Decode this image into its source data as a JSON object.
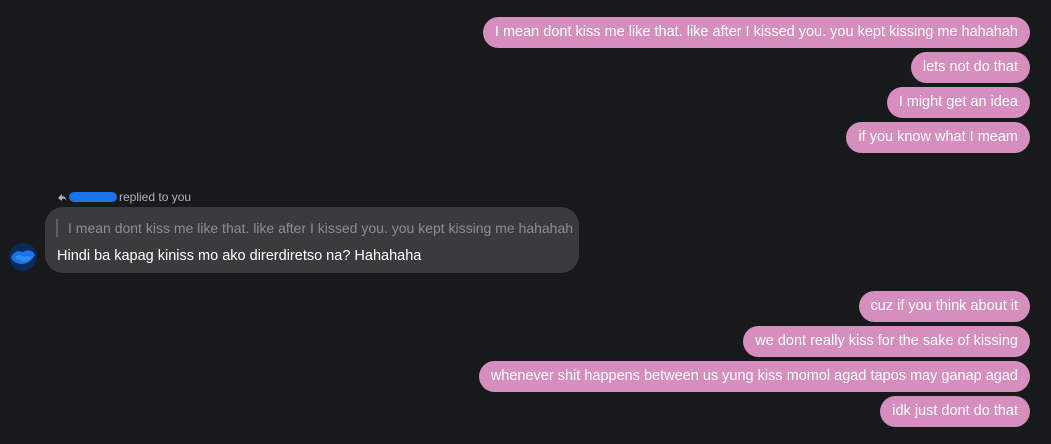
{
  "outgoing_top": [
    "I mean dont kiss me like that. like after I kissed you. you kept kissing me hahahah",
    "lets not do that",
    "I might get an idea",
    "if you know what I meam"
  ],
  "reply": {
    "header_text": "replied to you",
    "quoted_text": "I mean dont kiss me like that. like after I kissed you. you kept kissing me hahahah",
    "message_text": "Hindi ba kapag kiniss mo ako direrdiretso na? Hahahaha"
  },
  "outgoing_bottom": [
    "cuz if you think about it",
    "we dont really kiss for the sake of kissing",
    "whenever shit happens between us yung kiss momol agad tapos may ganap agad",
    "idk just dont do that"
  ],
  "colors": {
    "background": "#18191b",
    "outgoing_bubble": "#d58ebd",
    "incoming_bubble": "#3a3b3c",
    "redaction": "#1a73e8"
  },
  "icons": {
    "reply": "reply-arrow-icon"
  }
}
